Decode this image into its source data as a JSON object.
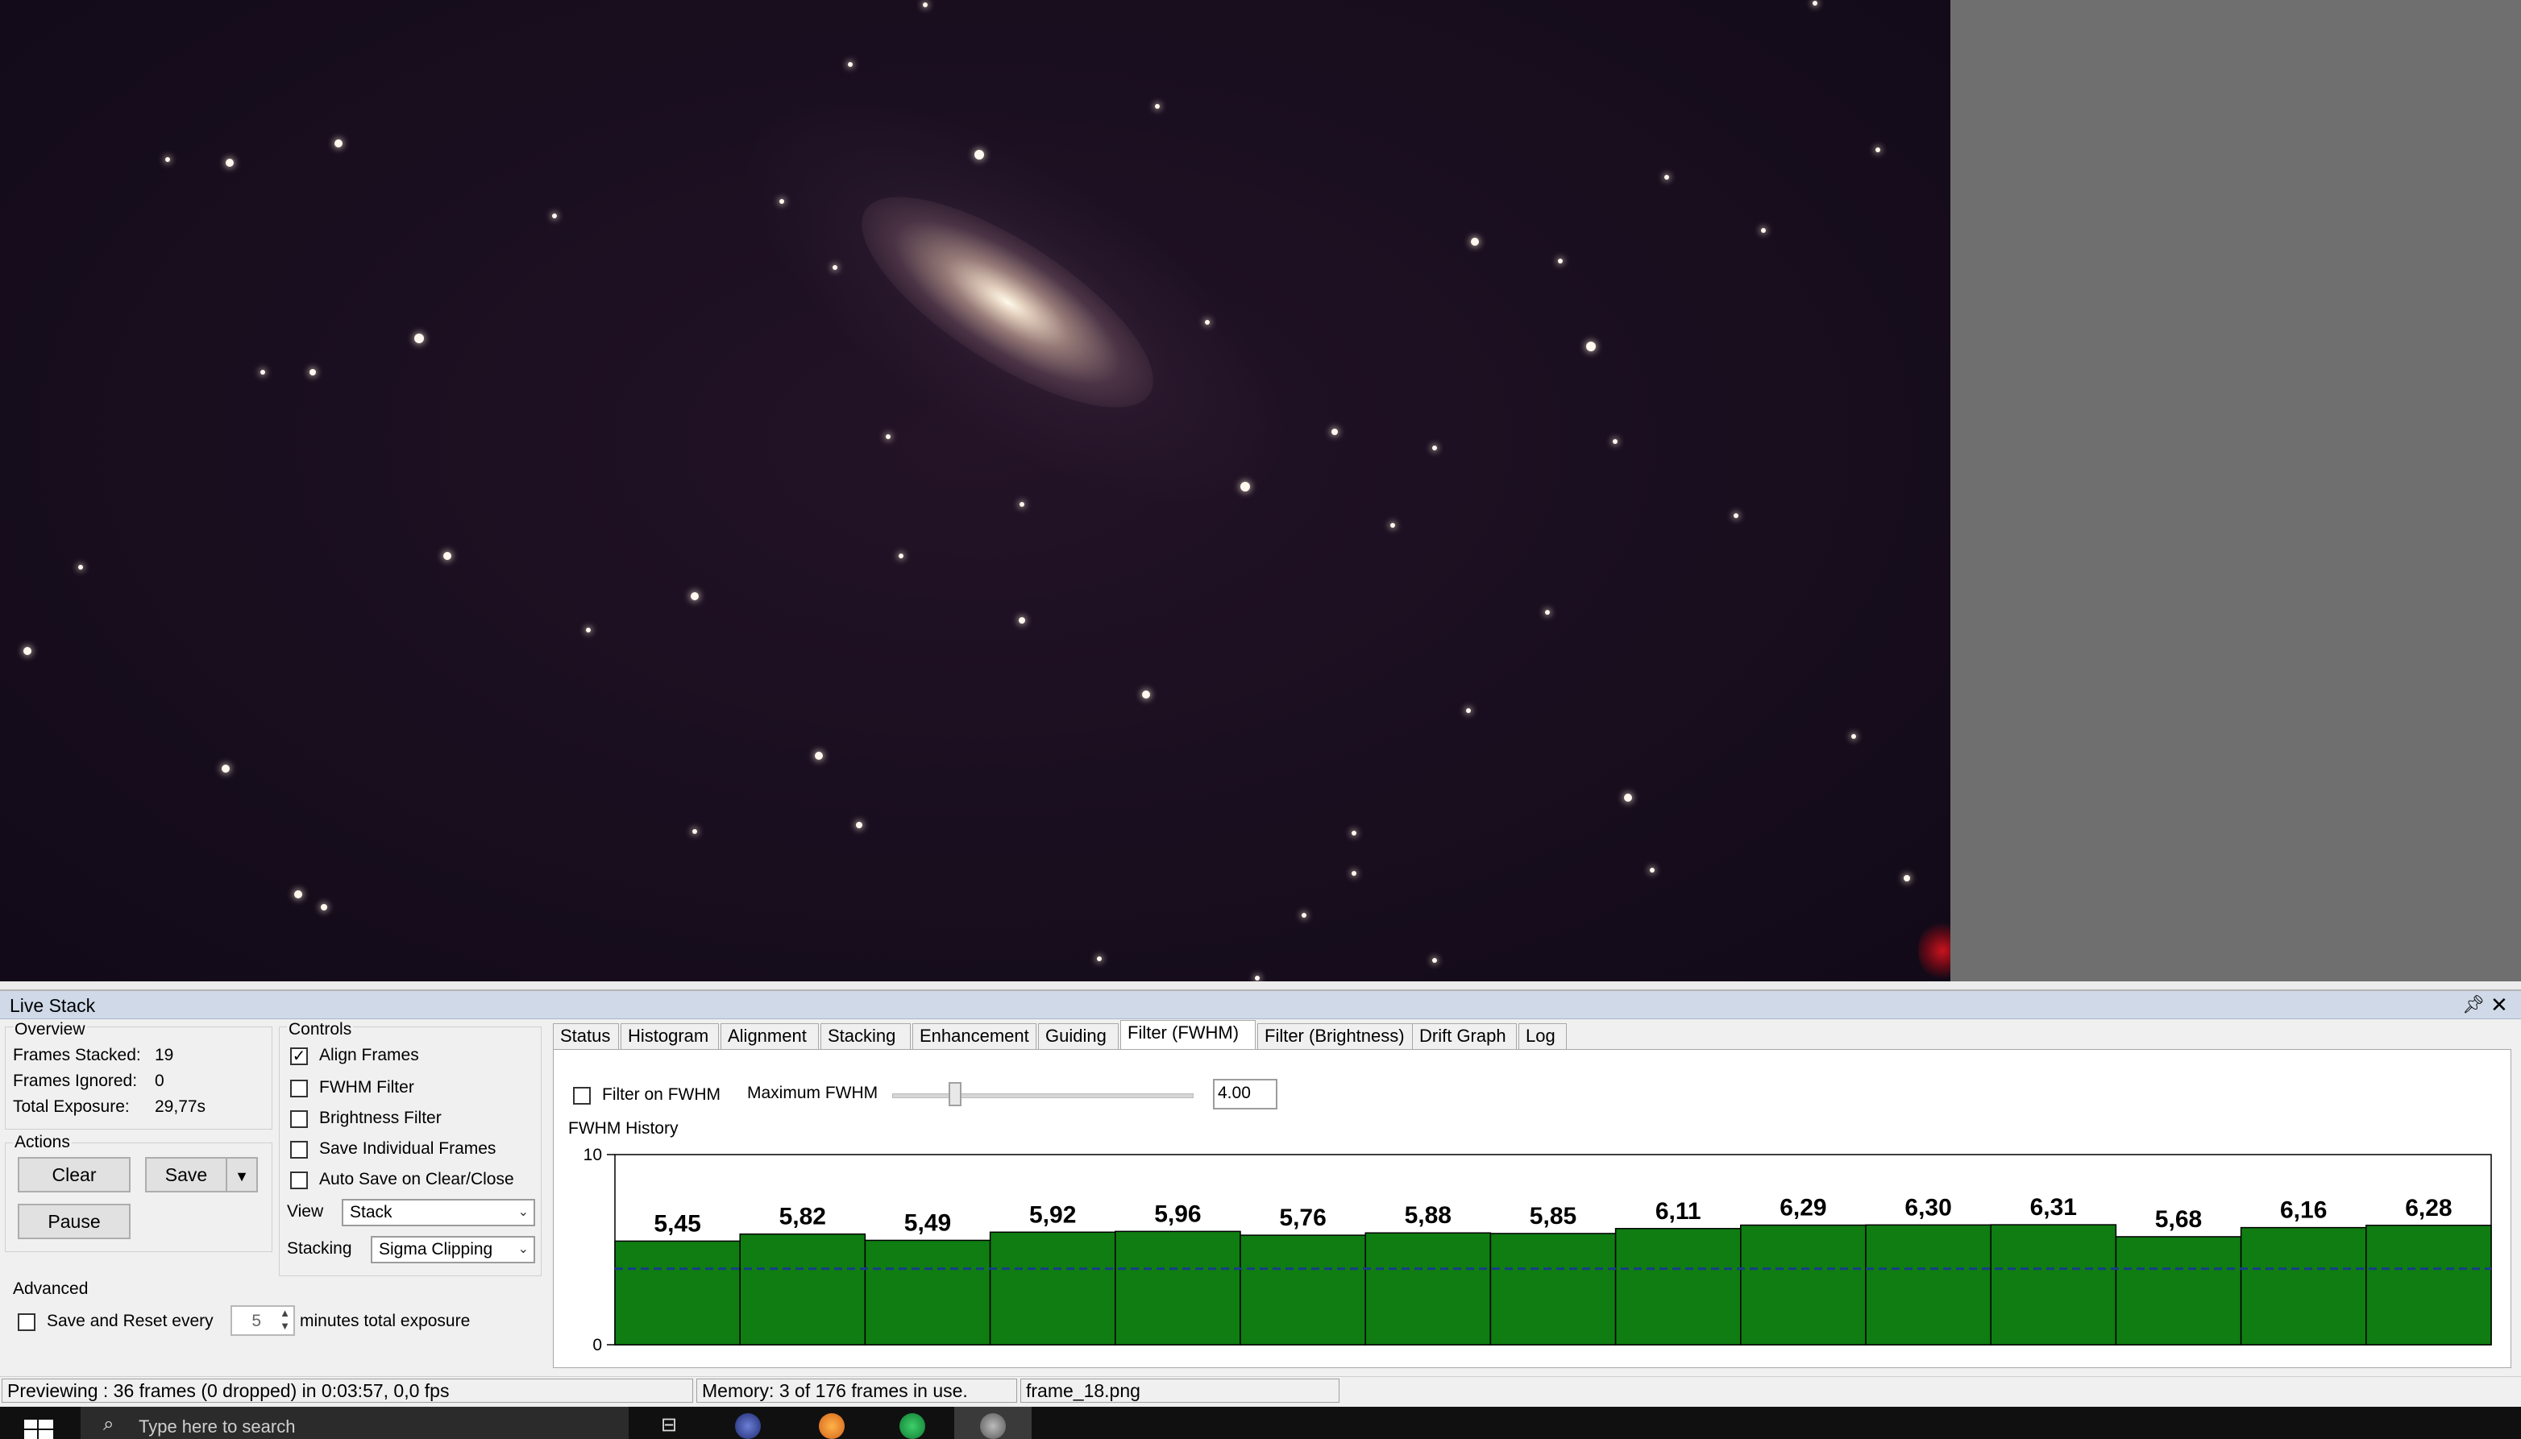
{
  "panel": {
    "title": "Live Stack",
    "overview": {
      "heading": "Overview",
      "frames_stacked_label": "Frames Stacked:",
      "frames_stacked_value": "19",
      "frames_ignored_label": "Frames Ignored:",
      "frames_ignored_value": "0",
      "total_exposure_label": "Total Exposure:",
      "total_exposure_value": "29,77s"
    },
    "actions": {
      "heading": "Actions",
      "clear": "Clear",
      "save": "Save",
      "pause": "Pause"
    },
    "controls": {
      "heading": "Controls",
      "align_frames": "Align Frames",
      "align_frames_checked": true,
      "fwhm_filter": "FWHM Filter",
      "brightness_filter": "Brightness Filter",
      "save_individual_frames": "Save Individual Frames",
      "auto_save": "Auto Save on Clear/Close",
      "view_label": "View",
      "view_value": "Stack",
      "stacking_label": "Stacking",
      "stacking_value": "Sigma Clipping"
    },
    "advanced": {
      "heading": "Advanced",
      "save_reset_label": "Save and Reset every",
      "save_reset_value": "5",
      "minutes_label": "minutes total exposure"
    },
    "tabs": [
      "Status",
      "Histogram",
      "Alignment",
      "Stacking",
      "Enhancement",
      "Guiding",
      "Filter (FWHM)",
      "Filter (Brightness)",
      "Drift Graph",
      "Log"
    ],
    "active_tab": "Filter (FWHM)",
    "fwhm": {
      "filter_label": "Filter on FWHM",
      "max_label": "Maximum FWHM",
      "max_value": "4.00",
      "history_label": "FWHM History"
    }
  },
  "chart_data": {
    "type": "bar",
    "title": "FWHM History",
    "ylim": [
      0,
      10
    ],
    "ytick_labels": [
      "10",
      "0"
    ],
    "threshold": 4.0,
    "values": [
      5.45,
      5.82,
      5.49,
      5.92,
      5.96,
      5.76,
      5.88,
      5.85,
      6.11,
      6.29,
      6.3,
      6.31,
      5.68,
      6.16,
      6.28
    ],
    "labels": [
      "5,45",
      "5,82",
      "5,49",
      "5,92",
      "5,96",
      "5,76",
      "5,88",
      "5,85",
      "6,11",
      "6,29",
      "6,30",
      "6,31",
      "5,68",
      "6,16",
      "6,28"
    ],
    "bar_color": "#0f7d12",
    "threshold_color": "#1a3d8a"
  },
  "statusbar": {
    "preview": "Previewing : 36 frames (0 dropped) in 0:03:57, 0,0 fps",
    "memory": "Memory: 3 of 176 frames in use.",
    "file": "frame_18.png"
  },
  "taskbar": {
    "search_placeholder": "Type here to search"
  }
}
